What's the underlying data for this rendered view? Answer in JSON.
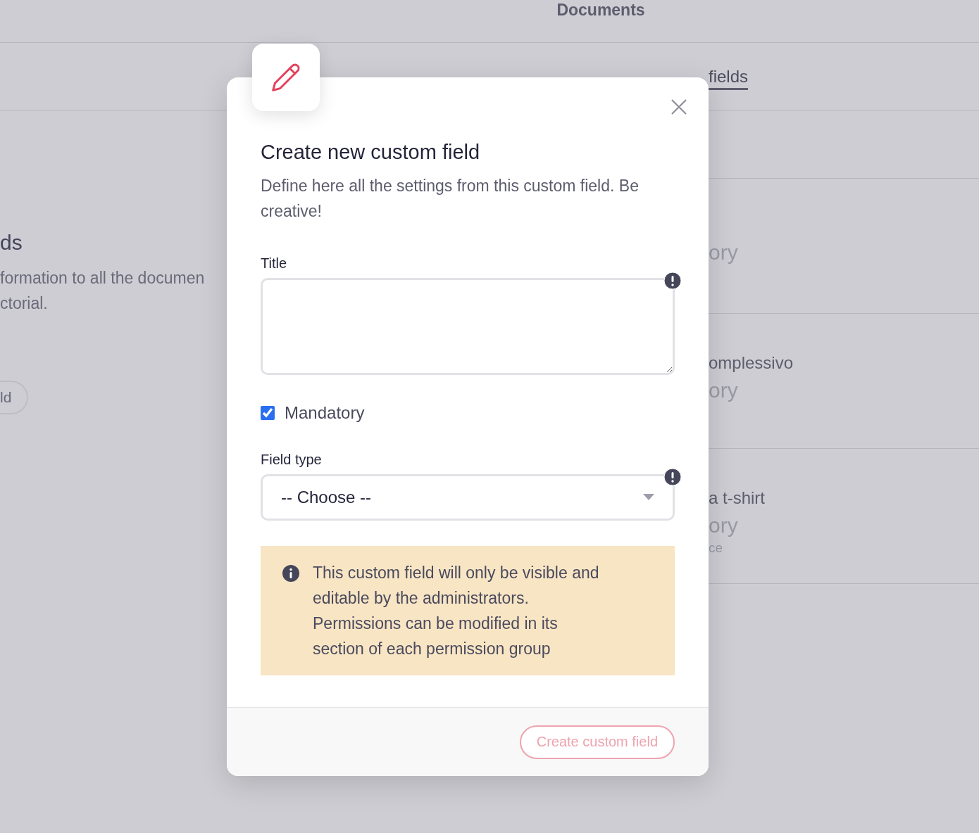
{
  "page": {
    "header": "Documents",
    "tabs": [
      {
        "label": "fields",
        "selected": true
      }
    ],
    "section": {
      "title": "ds",
      "description": [
        "formation to all the documen",
        "ctorial."
      ],
      "button": "ld"
    },
    "list": [
      {
        "status": "ory"
      },
      {
        "name": "omplessivo",
        "status": "ory"
      },
      {
        "name": "a t-shirt",
        "status": "ory",
        "note": "ce"
      }
    ]
  },
  "modal": {
    "title": "Create new custom field",
    "description": "Define here all the settings from this custom field. Be creative!",
    "fields": [
      {
        "kind": "textarea",
        "label": "Title",
        "required": true
      },
      {
        "kind": "checkbox",
        "label": "Mandatory",
        "checked": true
      },
      {
        "kind": "select",
        "label": "Field type",
        "value": "-- Choose --",
        "required": true
      }
    ],
    "notice": "This custom field will only be visible and editable by the administrators. Permissions can be modified in its section of each permission group",
    "submit": {
      "label": "Create custom field",
      "disabled": true
    }
  }
}
